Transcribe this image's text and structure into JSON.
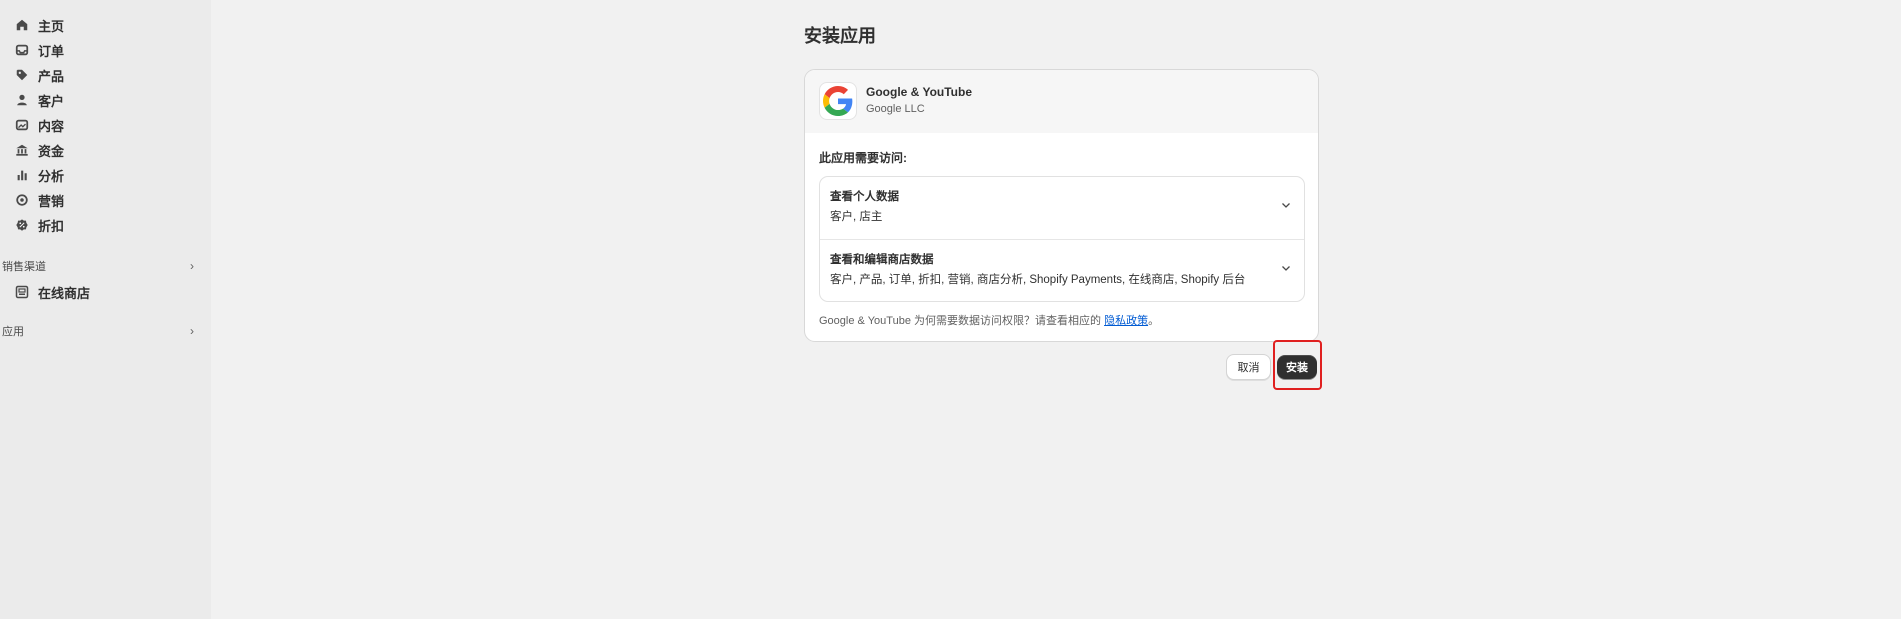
{
  "sidebar": {
    "nav": [
      {
        "label": "主页",
        "icon": "home-icon"
      },
      {
        "label": "订单",
        "icon": "inbox-icon"
      },
      {
        "label": "产品",
        "icon": "tag-icon"
      },
      {
        "label": "客户",
        "icon": "person-icon"
      },
      {
        "label": "内容",
        "icon": "image-icon"
      },
      {
        "label": "资金",
        "icon": "bank-icon"
      },
      {
        "label": "分析",
        "icon": "bar-chart-icon"
      },
      {
        "label": "营销",
        "icon": "target-icon"
      },
      {
        "label": "折扣",
        "icon": "discount-icon"
      }
    ],
    "sales_channels": {
      "label": "销售渠道",
      "items": [
        {
          "label": "在线商店",
          "icon": "store-icon"
        }
      ]
    },
    "apps": {
      "label": "应用"
    }
  },
  "page": {
    "title": "安装应用"
  },
  "app": {
    "name": "Google & YouTube",
    "developer": "Google LLC"
  },
  "access": {
    "title": "此应用需要访问:",
    "permissions": [
      {
        "title": "查看个人数据",
        "desc": "客户, 店主"
      },
      {
        "title": "查看和编辑商店数据",
        "desc": "客户, 产品, 订单, 折扣, 营销, 商店分析, Shopify Payments, 在线商店, Shopify 后台"
      }
    ],
    "note": "Google & YouTube 为何需要数据访问权限？请查看相应的",
    "privacy_link": "隐私政策",
    "note_end": "。"
  },
  "actions": {
    "cancel": "取消",
    "install": "安装"
  },
  "colors": {
    "primary_button": "#303030",
    "link": "#005bd3",
    "highlight": "#e02020"
  }
}
